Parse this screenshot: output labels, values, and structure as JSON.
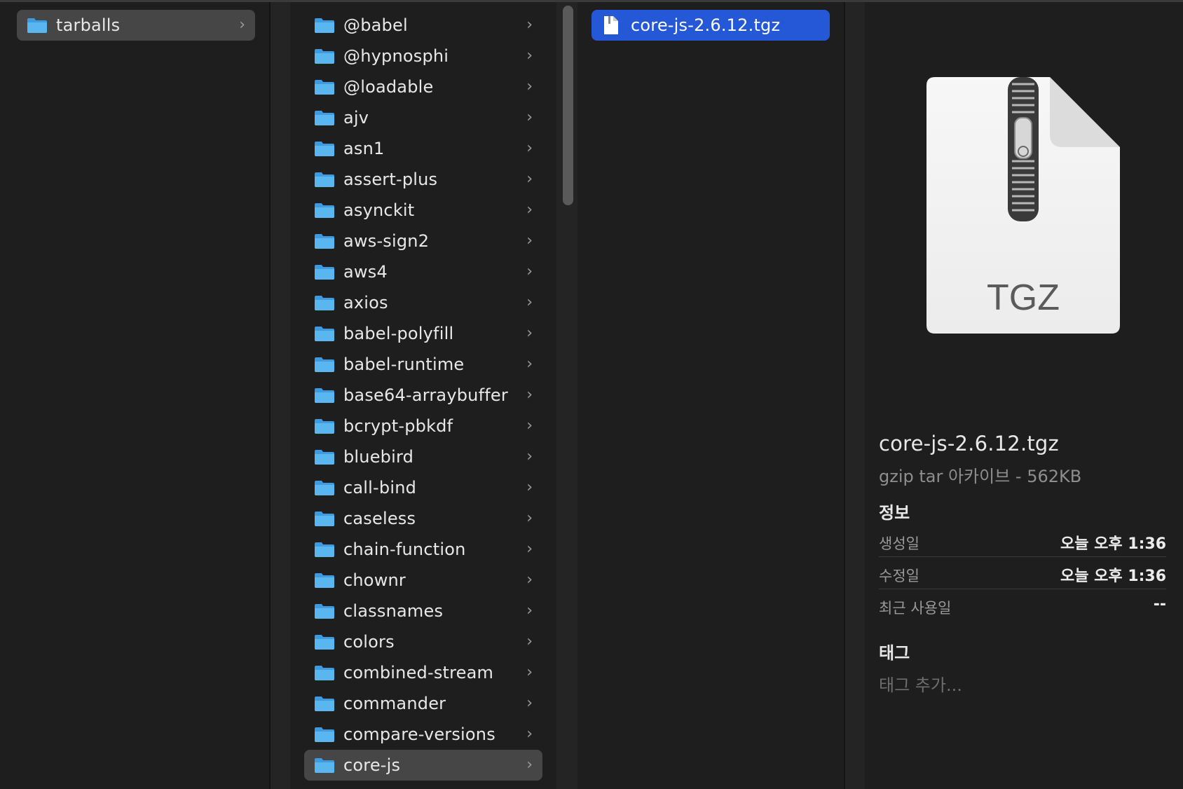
{
  "columns": {
    "col1": {
      "items": [
        {
          "label": "tarballs",
          "selected": true
        }
      ]
    },
    "col2": {
      "items": [
        {
          "label": "@babel"
        },
        {
          "label": "@hypnosphi"
        },
        {
          "label": "@loadable"
        },
        {
          "label": "ajv"
        },
        {
          "label": "asn1"
        },
        {
          "label": "assert-plus"
        },
        {
          "label": "asynckit"
        },
        {
          "label": "aws-sign2"
        },
        {
          "label": "aws4"
        },
        {
          "label": "axios"
        },
        {
          "label": "babel-polyfill"
        },
        {
          "label": "babel-runtime"
        },
        {
          "label": "base64-arraybuffer"
        },
        {
          "label": "bcrypt-pbkdf"
        },
        {
          "label": "bluebird"
        },
        {
          "label": "call-bind"
        },
        {
          "label": "caseless"
        },
        {
          "label": "chain-function"
        },
        {
          "label": "chownr"
        },
        {
          "label": "classnames"
        },
        {
          "label": "colors"
        },
        {
          "label": "combined-stream"
        },
        {
          "label": "commander"
        },
        {
          "label": "compare-versions"
        },
        {
          "label": "core-js",
          "selected": true
        }
      ]
    },
    "col3": {
      "items": [
        {
          "label": "core-js-2.6.12.tgz",
          "selected": true
        }
      ]
    }
  },
  "preview": {
    "icon_text": "TGZ",
    "file_name": "core-js-2.6.12.tgz",
    "kind_size": "gzip tar 아카이브 - 562KB",
    "info_heading": "정보",
    "info": [
      {
        "key": "생성일",
        "value": "오늘 오후 1:36"
      },
      {
        "key": "수정일",
        "value": "오늘 오후 1:36"
      },
      {
        "key": "최근 사용일",
        "value": "--"
      }
    ],
    "tags_heading": "태그",
    "tags_placeholder": "태그 추가..."
  },
  "colors": {
    "background": "#1e1e1e",
    "selection_gray": "#464646",
    "selection_blue": "#2558d6",
    "folder_blue": "#5ab6ef"
  },
  "icons": {
    "folder": "folder-icon",
    "chevron": "chevron-right-icon",
    "file": "document-icon",
    "archive": "zip-archive-icon"
  }
}
